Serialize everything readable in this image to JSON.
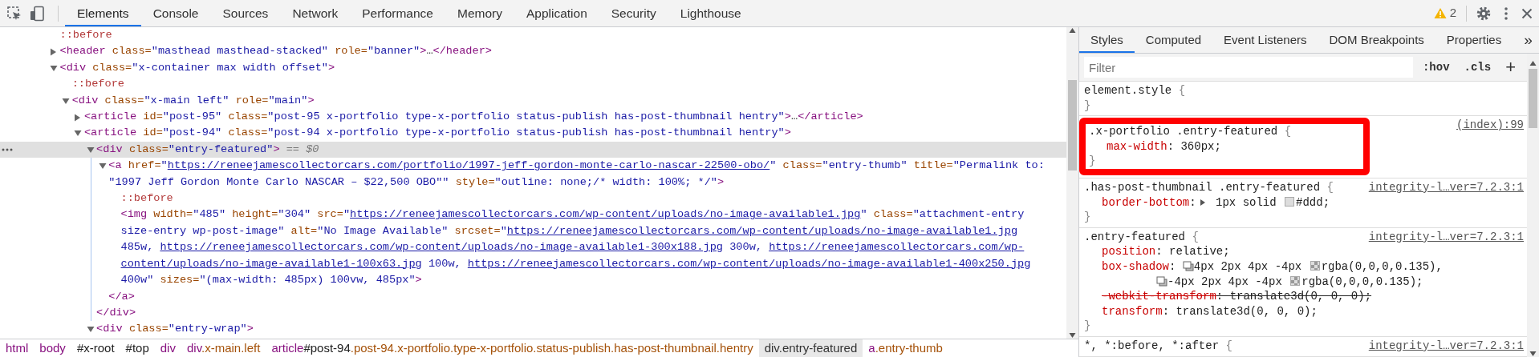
{
  "tabs": [
    {
      "label": "Elements",
      "selected": true
    },
    {
      "label": "Console",
      "selected": false
    },
    {
      "label": "Sources",
      "selected": false
    },
    {
      "label": "Network",
      "selected": false
    },
    {
      "label": "Performance",
      "selected": false
    },
    {
      "label": "Memory",
      "selected": false
    },
    {
      "label": "Application",
      "selected": false
    },
    {
      "label": "Security",
      "selected": false
    },
    {
      "label": "Lighthouse",
      "selected": false
    }
  ],
  "warnings": {
    "count": "2"
  },
  "dom": [
    {
      "lines": [
        [
          {
            "kind": "pseudo",
            "text": "::before"
          }
        ]
      ],
      "selected": false
    },
    {
      "lines": [
        [
          {
            "kind": "tag",
            "text": "<header"
          },
          {
            "kind": "attr",
            "text": " class="
          },
          {
            "kind": "val",
            "text": "\"masthead masthead-stacked\""
          },
          {
            "kind": "attr",
            "text": " role="
          },
          {
            "kind": "val",
            "text": "\"banner\""
          },
          {
            "kind": "tag",
            "text": ">"
          },
          {
            "kind": "text",
            "text": "…"
          },
          {
            "kind": "tag",
            "text": "</header>"
          }
        ]
      ],
      "expanded": false,
      "selected": false
    },
    {
      "lines": [
        [
          {
            "kind": "tag",
            "text": "<div"
          },
          {
            "kind": "attr",
            "text": " class="
          },
          {
            "kind": "val",
            "text": "\"x-container max width offset\""
          },
          {
            "kind": "tag",
            "text": ">"
          }
        ]
      ],
      "expanded": true,
      "selected": false,
      "children": [
        {
          "lines": [
            [
              {
                "kind": "pseudo",
                "text": "::before"
              }
            ]
          ],
          "selected": false
        },
        {
          "lines": [
            [
              {
                "kind": "tag",
                "text": "<div"
              },
              {
                "kind": "attr",
                "text": " class="
              },
              {
                "kind": "val",
                "text": "\"x-main left\""
              },
              {
                "kind": "attr",
                "text": " role="
              },
              {
                "kind": "val",
                "text": "\"main\""
              },
              {
                "kind": "tag",
                "text": ">"
              }
            ]
          ],
          "expanded": true,
          "selected": false,
          "children": [
            {
              "lines": [
                [
                  {
                    "kind": "tag",
                    "text": "<article"
                  },
                  {
                    "kind": "attr",
                    "text": " id="
                  },
                  {
                    "kind": "val",
                    "text": "\"post-95\""
                  },
                  {
                    "kind": "attr",
                    "text": " class="
                  },
                  {
                    "kind": "val",
                    "text": "\"post-95 x-portfolio type-x-portfolio status-publish has-post-thumbnail hentry\""
                  },
                  {
                    "kind": "tag",
                    "text": ">"
                  },
                  {
                    "kind": "text",
                    "text": "…"
                  },
                  {
                    "kind": "tag",
                    "text": "</article>"
                  }
                ]
              ],
              "expanded": false,
              "selected": false
            },
            {
              "lines": [
                [
                  {
                    "kind": "tag",
                    "text": "<article"
                  },
                  {
                    "kind": "attr",
                    "text": " id="
                  },
                  {
                    "kind": "val",
                    "text": "\"post-94\""
                  },
                  {
                    "kind": "attr",
                    "text": " class="
                  },
                  {
                    "kind": "val",
                    "text": "\"post-94 x-portfolio type-x-portfolio status-publish has-post-thumbnail hentry\""
                  },
                  {
                    "kind": "tag",
                    "text": ">"
                  }
                ]
              ],
              "expanded": true,
              "selected": false,
              "children": [
                {
                  "lines": [
                    [
                      {
                        "kind": "tag",
                        "text": "<div"
                      },
                      {
                        "kind": "attr",
                        "text": " class="
                      },
                      {
                        "kind": "val",
                        "text": "\"entry-featured\""
                      },
                      {
                        "kind": "tag",
                        "text": ">"
                      },
                      {
                        "kind": "note",
                        "text": " == $0"
                      }
                    ]
                  ],
                  "expanded": true,
                  "selected": true,
                  "closing": [
                    {
                      "kind": "tag",
                      "text": "</div>"
                    }
                  ],
                  "children": [
                    {
                      "lines": [
                        [
                          {
                            "kind": "tag",
                            "text": "<a"
                          },
                          {
                            "kind": "attr",
                            "text": " href="
                          },
                          {
                            "kind": "val",
                            "text": "\""
                          },
                          {
                            "kind": "link",
                            "text": "https://reneejamescollectorcars.com/portfolio/1997-jeff-gordon-monte-carlo-nascar-22500-obo/"
                          },
                          {
                            "kind": "val",
                            "text": "\""
                          },
                          {
                            "kind": "attr",
                            "text": " class="
                          },
                          {
                            "kind": "val",
                            "text": "\"entry-thumb\""
                          },
                          {
                            "kind": "attr",
                            "text": " title="
                          },
                          {
                            "kind": "val",
                            "text": "\"Permalink to:"
                          }
                        ],
                        [
                          {
                            "kind": "val",
                            "text": "\"1997 Jeff Gordon Monte Carlo NASCAR – $22,500 OBO\"\""
                          },
                          {
                            "kind": "attr",
                            "text": " style="
                          },
                          {
                            "kind": "val",
                            "text": "\"outline: none;/* width: 100%; */\""
                          },
                          {
                            "kind": "tag",
                            "text": ">"
                          }
                        ]
                      ],
                      "expanded": true,
                      "selected": false,
                      "closing": [
                        {
                          "kind": "tag",
                          "text": "</a>"
                        }
                      ],
                      "children": [
                        {
                          "lines": [
                            [
                              {
                                "kind": "pseudo",
                                "text": "::before"
                              }
                            ]
                          ],
                          "selected": false
                        },
                        {
                          "lines": [
                            [
                              {
                                "kind": "tag",
                                "text": "<img"
                              },
                              {
                                "kind": "attr",
                                "text": " width="
                              },
                              {
                                "kind": "val",
                                "text": "\"485\""
                              },
                              {
                                "kind": "attr",
                                "text": " height="
                              },
                              {
                                "kind": "val",
                                "text": "\"304\""
                              },
                              {
                                "kind": "attr",
                                "text": " src="
                              },
                              {
                                "kind": "val",
                                "text": "\""
                              },
                              {
                                "kind": "link",
                                "text": "https://reneejamescollectorcars.com/wp-content/uploads/no-image-available1.jpg"
                              },
                              {
                                "kind": "val",
                                "text": "\""
                              },
                              {
                                "kind": "attr",
                                "text": " class="
                              },
                              {
                                "kind": "val",
                                "text": "\"attachment-entry"
                              }
                            ],
                            [
                              {
                                "kind": "val",
                                "text": "size-entry wp-post-image\""
                              },
                              {
                                "kind": "attr",
                                "text": " alt="
                              },
                              {
                                "kind": "val",
                                "text": "\"No Image Available\""
                              },
                              {
                                "kind": "attr",
                                "text": " srcset="
                              },
                              {
                                "kind": "val",
                                "text": "\""
                              },
                              {
                                "kind": "link",
                                "text": "https://reneejamescollectorcars.com/wp-content/uploads/no-image-available1.jpg"
                              }
                            ],
                            [
                              {
                                "kind": "val",
                                "text": "485w, "
                              },
                              {
                                "kind": "link",
                                "text": "https://reneejamescollectorcars.com/wp-content/uploads/no-image-available1-300x188.jpg"
                              },
                              {
                                "kind": "val",
                                "text": " 300w, "
                              },
                              {
                                "kind": "link",
                                "text": "https://reneejamescollectorcars.com/wp-"
                              }
                            ],
                            [
                              {
                                "kind": "link",
                                "text": "content/uploads/no-image-available1-100x63.jpg"
                              },
                              {
                                "kind": "val",
                                "text": " 100w, "
                              },
                              {
                                "kind": "link",
                                "text": "https://reneejamescollectorcars.com/wp-content/uploads/no-image-available1-400x250.jpg"
                              }
                            ],
                            [
                              {
                                "kind": "val",
                                "text": "400w\""
                              },
                              {
                                "kind": "attr",
                                "text": " sizes="
                              },
                              {
                                "kind": "val",
                                "text": "\"(max-width: 485px) 100vw, 485px\""
                              },
                              {
                                "kind": "tag",
                                "text": ">"
                              }
                            ]
                          ],
                          "selected": false
                        }
                      ]
                    }
                  ]
                },
                {
                  "lines": [
                    [
                      {
                        "kind": "tag",
                        "text": "<div"
                      },
                      {
                        "kind": "attr",
                        "text": " class="
                      },
                      {
                        "kind": "val",
                        "text": "\"entry-wrap\""
                      },
                      {
                        "kind": "tag",
                        "text": ">"
                      }
                    ]
                  ],
                  "expanded": true,
                  "selected": false
                }
              ]
            }
          ]
        }
      ]
    }
  ],
  "breadcrumbs": [
    {
      "parts": [
        {
          "kind": "tag",
          "text": "html"
        }
      ],
      "selected": false
    },
    {
      "parts": [
        {
          "kind": "tag",
          "text": "body"
        }
      ],
      "selected": false
    },
    {
      "parts": [
        {
          "kind": "id",
          "text": "#x-root"
        }
      ],
      "selected": false
    },
    {
      "parts": [
        {
          "kind": "id",
          "text": "#top"
        }
      ],
      "selected": false
    },
    {
      "parts": [
        {
          "kind": "tag",
          "text": "div"
        }
      ],
      "selected": false
    },
    {
      "parts": [
        {
          "kind": "tag",
          "text": "div"
        },
        {
          "kind": "class",
          "text": ".x-main.left"
        }
      ],
      "selected": false
    },
    {
      "parts": [
        {
          "kind": "tag",
          "text": "article"
        },
        {
          "kind": "id",
          "text": "#post-94"
        },
        {
          "kind": "class",
          "text": ".post-94.x-portfolio.type-x-portfolio.status-publish.has-post-thumbnail.hentry"
        }
      ],
      "selected": false
    },
    {
      "parts": [
        {
          "kind": "tag",
          "text": "div"
        },
        {
          "kind": "class",
          "text": ".entry-featured"
        }
      ],
      "selected": true
    },
    {
      "parts": [
        {
          "kind": "tag",
          "text": "a"
        },
        {
          "kind": "class",
          "text": ".entry-thumb"
        }
      ],
      "selected": false
    }
  ],
  "styles": {
    "tabs": [
      {
        "label": "Styles",
        "selected": true
      },
      {
        "label": "Computed",
        "selected": false
      },
      {
        "label": "Event Listeners",
        "selected": false
      },
      {
        "label": "DOM Breakpoints",
        "selected": false
      },
      {
        "label": "Properties",
        "selected": false
      }
    ],
    "more_tabs": "»",
    "filter": {
      "placeholder": "Filter"
    },
    "buttons": [
      ":hov",
      ".cls",
      "+"
    ],
    "rules": [
      {
        "selector": "element.style",
        "open": "{",
        "close": "}",
        "highlighted": false
      },
      {
        "selector": ".x-portfolio .entry-featured",
        "open": "{",
        "close": "}",
        "source": "(index):99",
        "highlighted": true,
        "declarations": [
          {
            "property": "max-width",
            "struck": false,
            "value": [
              {
                "kind": "text",
                "text": ": 360px;"
              }
            ]
          }
        ]
      },
      {
        "selector": ".has-post-thumbnail .entry-featured",
        "open": "{",
        "close": "}",
        "source": "integrity-l…ver=7.2.3:1",
        "highlighted": false,
        "declarations": [
          {
            "property": "border-bottom",
            "struck": false,
            "value": [
              {
                "kind": "text",
                "text": ":"
              },
              {
                "kind": "expander"
              },
              {
                "kind": "text",
                "text": " 1px solid "
              },
              {
                "kind": "swatch",
                "color": "#dddddd"
              },
              {
                "kind": "text",
                "text": "#ddd;"
              }
            ]
          }
        ]
      },
      {
        "selector": ".entry-featured",
        "open": "{",
        "close": "}",
        "source": "integrity-l…ver=7.2.3:1",
        "highlighted": false,
        "declarations": [
          {
            "property": "position",
            "struck": false,
            "value": [
              {
                "kind": "text",
                "text": ": relative;"
              }
            ]
          },
          {
            "property": "box-shadow",
            "struck": false,
            "value": [
              {
                "kind": "text",
                "text": ": "
              },
              {
                "kind": "shadow"
              },
              {
                "kind": "text",
                "text": "4px 2px 4px -4px "
              },
              {
                "kind": "alpha-swatch"
              },
              {
                "kind": "text",
                "text": "rgba(0,0,0,0.135),"
              },
              {
                "kind": "break"
              },
              {
                "kind": "shadow"
              },
              {
                "kind": "text",
                "text": "-4px 2px 4px -4px "
              },
              {
                "kind": "alpha-swatch"
              },
              {
                "kind": "text",
                "text": "rgba(0,0,0,0.135);"
              }
            ]
          },
          {
            "property": "-webkit-transform",
            "struck": true,
            "value": [
              {
                "kind": "text",
                "text": ": translate3d(0, 0, 0);"
              }
            ]
          },
          {
            "property": "transform",
            "struck": false,
            "value": [
              {
                "kind": "text",
                "text": ": translate3d(0, 0, 0);"
              }
            ]
          }
        ]
      },
      {
        "selector": "*, *:before, *:after",
        "open": "{",
        "source": "integrity-l…ver=7.2.3:1",
        "highlighted": false
      }
    ]
  }
}
